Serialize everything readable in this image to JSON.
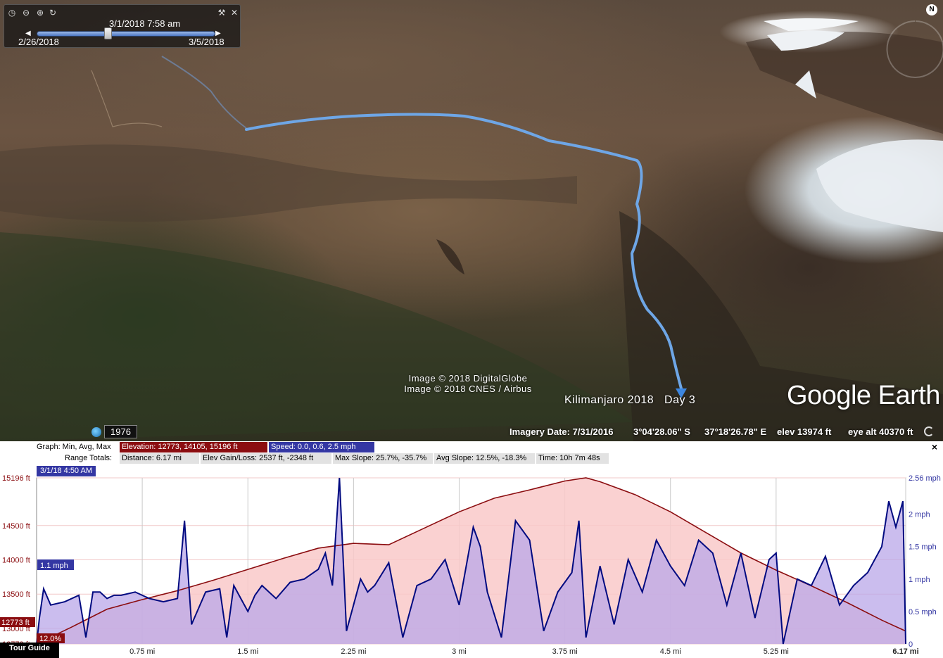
{
  "map": {
    "time_slider": {
      "current_time": "3/1/2018  7:58 am",
      "start_date": "2/26/2018",
      "end_date": "3/5/2018"
    },
    "compass_label": "N",
    "credits": [
      "Image © 2018 DigitalGlobe",
      "Image © 2018 CNES / Airbus"
    ],
    "tour_title": "Kilimanjaro 2018   Day 3",
    "logo_text": "Google Earth",
    "historical_year": "1976",
    "status": {
      "imagery_date": "Imagery Date: 7/31/2016",
      "latitude": "3°04'28.06\" S",
      "longitude": "37°18'26.78\" E",
      "elevation": "elev 13974 ft",
      "eye_alt": "eye alt  40370 ft"
    },
    "icons": [
      "clock-icon",
      "zoom-out-icon",
      "zoom-in-icon",
      "reset-icon",
      "wrench-icon",
      "close-icon"
    ]
  },
  "profile": {
    "graph_label": "Graph: Min, Avg, Max",
    "elevation_pill": "Elevation: 12773, 14105, 15196 ft",
    "speed_pill": "Speed: 0.0, 0.6, 2.5 mph",
    "range_label": "Range Totals:",
    "totals": [
      "Distance: 6.17 mi",
      "Elev Gain/Loss: 2537 ft, -2348 ft",
      "Max Slope: 25.7%, -35.7%",
      "Avg Slope: 12.5%, -18.3%",
      "Time: 10h 7m 48s"
    ],
    "cursor_time": "3/1/18 4:50 AM",
    "speed_marker": "1.1 mph",
    "elev_marker": "12773 ft",
    "slope_marker": "12.0%",
    "tour_guide": "Tour Guide",
    "close_symbol": "×"
  },
  "chart_data": {
    "type": "area",
    "x_unit": "mi",
    "xlim": [
      0,
      6.17
    ],
    "x_ticks": [
      "0.75 mi",
      "1.5 mi",
      "2.25 mi",
      "3 mi",
      "3.75 mi",
      "4.5 mi",
      "5.25 mi",
      "6.17 mi"
    ],
    "x_tick_values": [
      0.75,
      1.5,
      2.25,
      3.0,
      3.75,
      4.5,
      5.25,
      6.17
    ],
    "y_left_ticks": [
      "15196 ft",
      "14500 ft",
      "14000 ft",
      "13500 ft",
      "13000 ft",
      "12773 ft"
    ],
    "y_left_tick_values": [
      15196,
      14500,
      14000,
      13500,
      13000,
      12773
    ],
    "ylim_left": [
      12773,
      15196
    ],
    "y_right_ticks": [
      "2.56 mph",
      "2 mph",
      "1.5 mph",
      "1 mph",
      "0.5 mph",
      "0"
    ],
    "y_right_tick_values": [
      2.56,
      2,
      1.5,
      1,
      0.5,
      0
    ],
    "ylim_right": [
      0,
      2.56
    ],
    "series": [
      {
        "name": "Elevation",
        "axis": "left",
        "color": "#8b0d10",
        "fill": "#f9c9c9",
        "x": [
          0,
          0.25,
          0.5,
          0.75,
          1.0,
          1.25,
          1.5,
          1.75,
          2.0,
          2.25,
          2.5,
          2.75,
          3.0,
          3.25,
          3.5,
          3.75,
          3.9,
          4.0,
          4.25,
          4.5,
          4.75,
          5.0,
          5.25,
          5.5,
          5.75,
          6.0,
          6.17
        ],
        "values": [
          12773,
          13020,
          13280,
          13420,
          13550,
          13700,
          13860,
          14020,
          14170,
          14240,
          14220,
          14460,
          14700,
          14900,
          15020,
          15150,
          15196,
          15140,
          14950,
          14700,
          14400,
          14100,
          13850,
          13620,
          13380,
          13120,
          12960
        ]
      },
      {
        "name": "Speed",
        "axis": "right",
        "color": "#000a80",
        "fill": "#b9a7e8",
        "x": [
          0,
          0.02,
          0.05,
          0.1,
          0.2,
          0.3,
          0.35,
          0.4,
          0.45,
          0.5,
          0.55,
          0.6,
          0.7,
          0.75,
          0.8,
          0.9,
          1.0,
          1.05,
          1.1,
          1.2,
          1.3,
          1.35,
          1.4,
          1.45,
          1.5,
          1.55,
          1.6,
          1.7,
          1.8,
          1.9,
          2.0,
          2.05,
          2.1,
          2.15,
          2.2,
          2.25,
          2.3,
          2.35,
          2.4,
          2.5,
          2.6,
          2.7,
          2.8,
          2.9,
          3.0,
          3.1,
          3.15,
          3.2,
          3.3,
          3.4,
          3.5,
          3.6,
          3.7,
          3.8,
          3.85,
          3.9,
          4.0,
          4.1,
          4.2,
          4.3,
          4.4,
          4.5,
          4.6,
          4.7,
          4.8,
          4.9,
          5.0,
          5.1,
          5.2,
          5.25,
          5.3,
          5.4,
          5.5,
          5.6,
          5.7,
          5.8,
          5.9,
          6.0,
          6.05,
          6.1,
          6.15,
          6.17
        ],
        "values": [
          0.0,
          0.4,
          0.85,
          0.6,
          0.65,
          0.75,
          0.1,
          0.8,
          0.8,
          0.7,
          0.75,
          0.75,
          0.8,
          0.75,
          0.7,
          0.65,
          0.7,
          1.9,
          0.3,
          0.8,
          0.85,
          0.1,
          0.9,
          0.7,
          0.5,
          0.75,
          0.9,
          0.7,
          0.95,
          1.0,
          1.15,
          1.4,
          0.9,
          2.56,
          0.2,
          0.6,
          1.0,
          0.8,
          0.9,
          1.25,
          0.1,
          0.9,
          1.0,
          1.3,
          0.6,
          1.8,
          1.5,
          0.8,
          0.1,
          1.9,
          1.6,
          0.2,
          0.8,
          1.1,
          1.9,
          0.1,
          1.2,
          0.3,
          1.3,
          0.8,
          1.6,
          1.2,
          0.9,
          1.6,
          1.4,
          0.6,
          1.4,
          0.4,
          1.3,
          1.4,
          0.0,
          1.0,
          0.9,
          1.35,
          0.6,
          0.9,
          1.1,
          1.5,
          2.2,
          1.8,
          2.2,
          0.0
        ]
      }
    ]
  }
}
